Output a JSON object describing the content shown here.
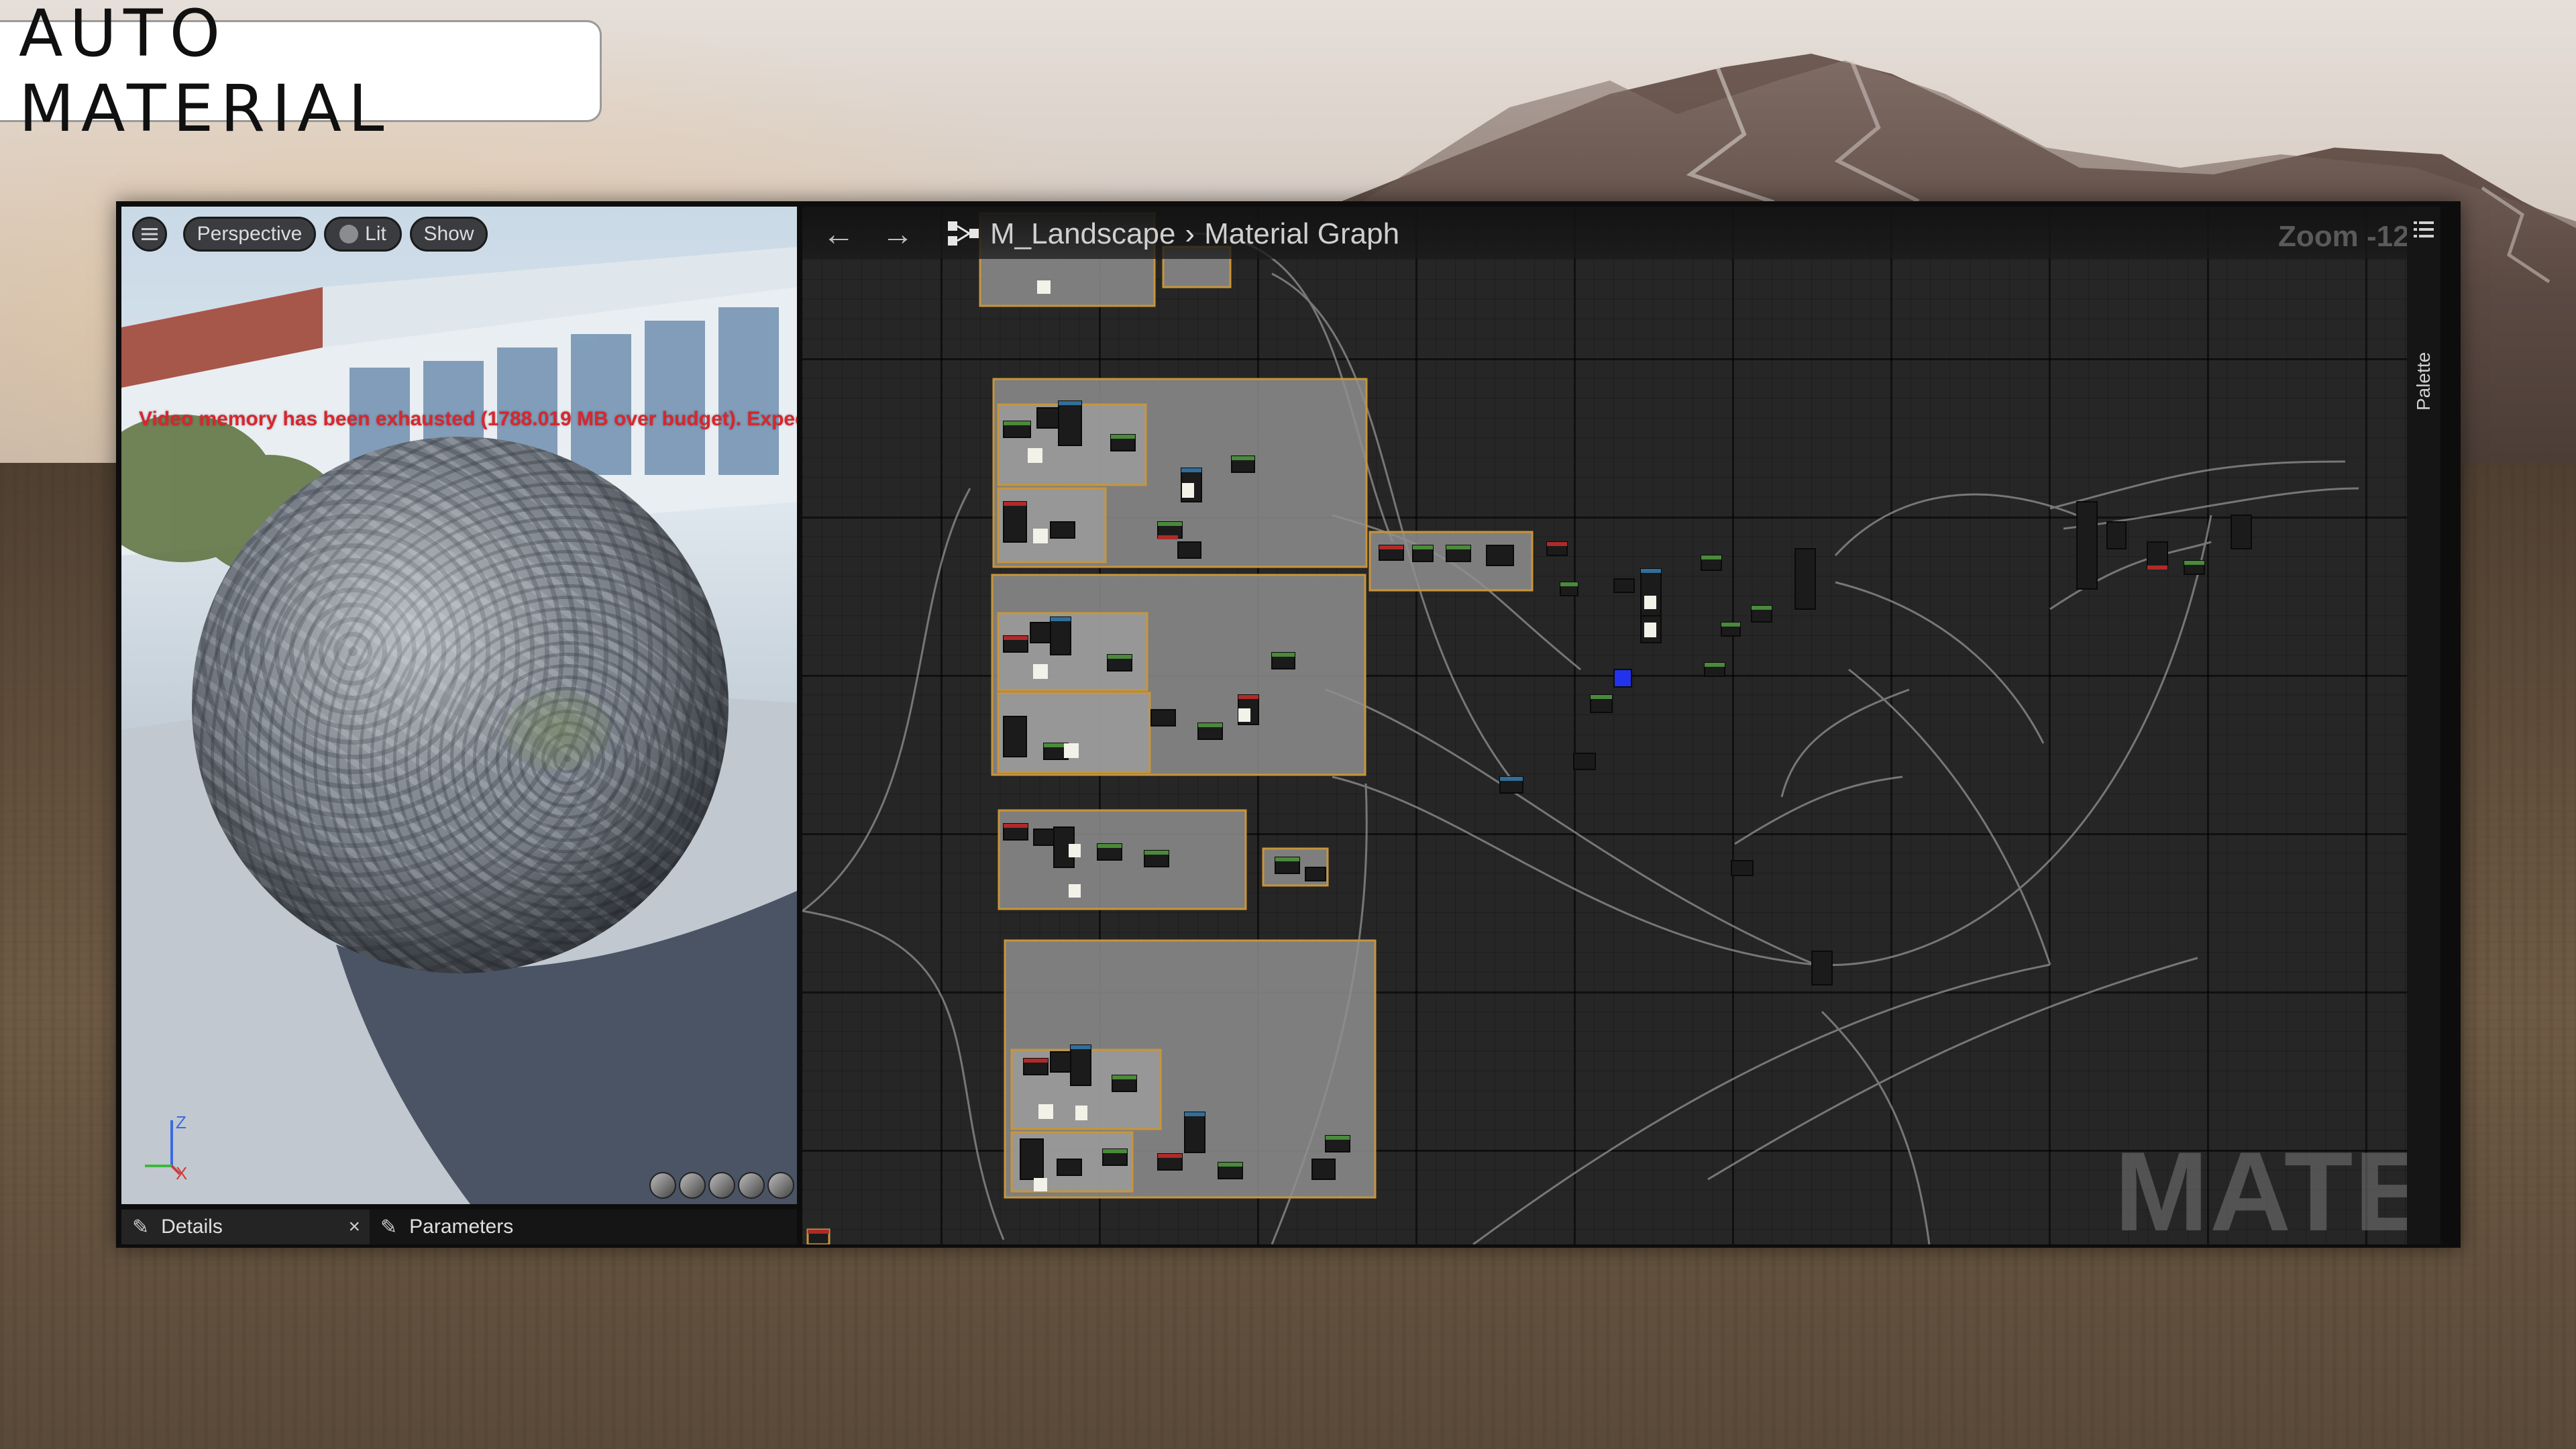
{
  "title_card": {
    "text": "AUTO MATERIAL"
  },
  "viewport": {
    "menu_icon": "hamburger-icon",
    "perspective_label": "Perspective",
    "lit_label": "Lit",
    "show_label": "Show",
    "warning": "Video memory has been exhausted (1788.019 MB over budget). Expec",
    "axis": {
      "z": "Z",
      "x": "X"
    }
  },
  "details_bar": {
    "details_label": "Details",
    "close_glyph": "×",
    "parameters_label": "Parameters"
  },
  "graph": {
    "back_icon": "arrow-left-icon",
    "forward_icon": "arrow-right-icon",
    "breadcrumb": {
      "asset": "M_Landscape",
      "separator": "›",
      "page": "Material Graph"
    },
    "zoom": "Zoom -12",
    "palette_label": "Palette",
    "watermark": "MATERIAL"
  },
  "colors": {
    "warning": "#d8262e",
    "graph_background": "#262626",
    "comment_box_border": "#c8953a",
    "comment_box_fill": "#8e8e8e"
  }
}
